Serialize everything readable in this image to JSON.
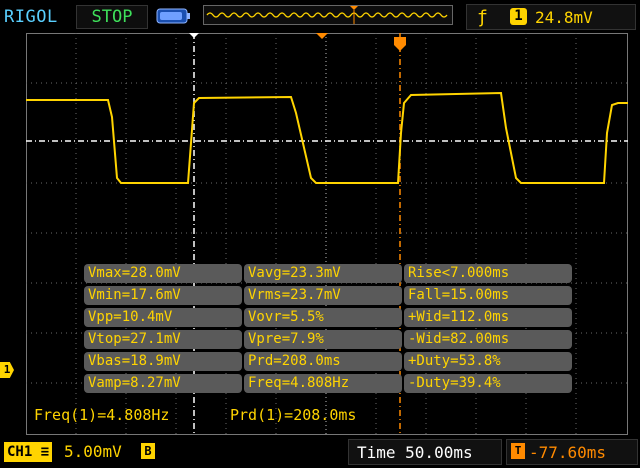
{
  "header": {
    "brand": "RIGOL",
    "run_state": "STOP",
    "trigger": {
      "edge_icon": "rising-edge-icon",
      "channel": "1",
      "level": "24.8mV"
    }
  },
  "measurements": [
    [
      "Vmax=28.0mV",
      "Vavg=23.3mV",
      "Rise<7.000ms"
    ],
    [
      "Vmin=17.6mV",
      "Vrms=23.7mV",
      "Fall=15.00ms"
    ],
    [
      "Vpp=10.4mV",
      "Vovr=5.5%",
      "+Wid=112.0ms"
    ],
    [
      "Vtop=27.1mV",
      "Vpre=7.9%",
      "-Wid=82.00ms"
    ],
    [
      "Vbas=18.9mV",
      "Prd=208.0ms",
      "+Duty=53.8%"
    ],
    [
      "Vamp=8.27mV",
      "Freq=4.808Hz",
      "-Duty=39.4%"
    ]
  ],
  "counters": {
    "freq": "Freq(1)=4.808Hz",
    "period": "Prd(1)=208.0ms"
  },
  "channel_marker": "1",
  "footer": {
    "channel": "CH1",
    "volts_per_div": "5.00mV",
    "bw_limit": "B",
    "timebase": "Time 50.00ms",
    "trigger_offset": "-77.60ms"
  },
  "colors": {
    "trace": "#ffd400",
    "accent": "#ff8a00",
    "brand": "#5ad0ff",
    "stop": "#3ee05a"
  }
}
